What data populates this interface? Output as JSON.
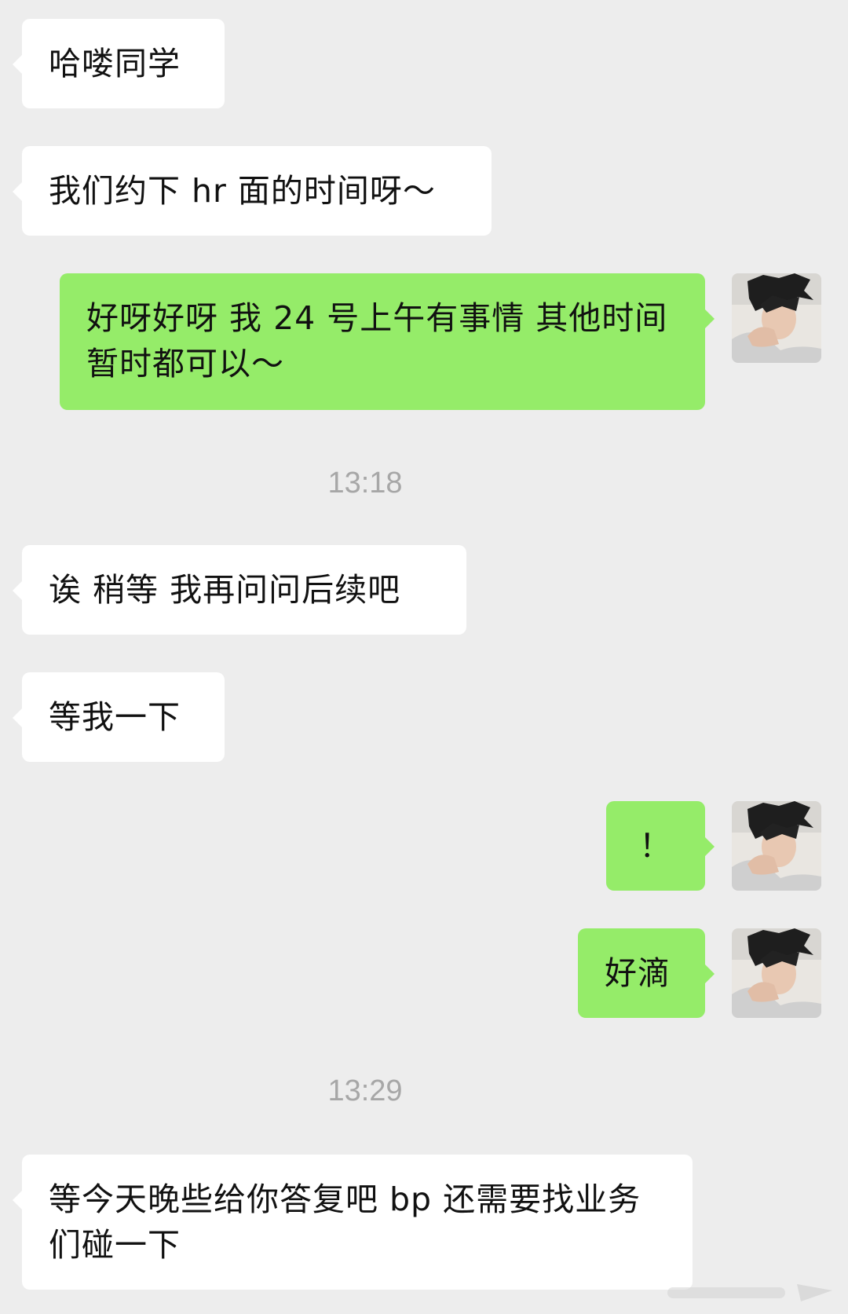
{
  "messages": [
    {
      "side": "in",
      "text": "哈喽同学"
    },
    {
      "side": "in",
      "text": "我们约下 hr 面的时间呀～"
    },
    {
      "side": "out",
      "text": "好呀好呀 我 24 号上午有事情 其他时间暂时都可以～"
    },
    {
      "time": "13:18"
    },
    {
      "side": "in",
      "text": "诶 稍等 我再问问后续吧"
    },
    {
      "side": "in",
      "text": "等我一下"
    },
    {
      "side": "out",
      "text": "！"
    },
    {
      "side": "out",
      "text": "好滴"
    },
    {
      "time": "13:29"
    },
    {
      "side": "in",
      "text": "等今天晚些给你答复吧 bp 还需要找业务们碰一下"
    }
  ],
  "colors": {
    "background": "#ededed",
    "incoming_bubble": "#ffffff",
    "outgoing_bubble": "#95ec69",
    "timestamp": "#a7a7a7"
  }
}
